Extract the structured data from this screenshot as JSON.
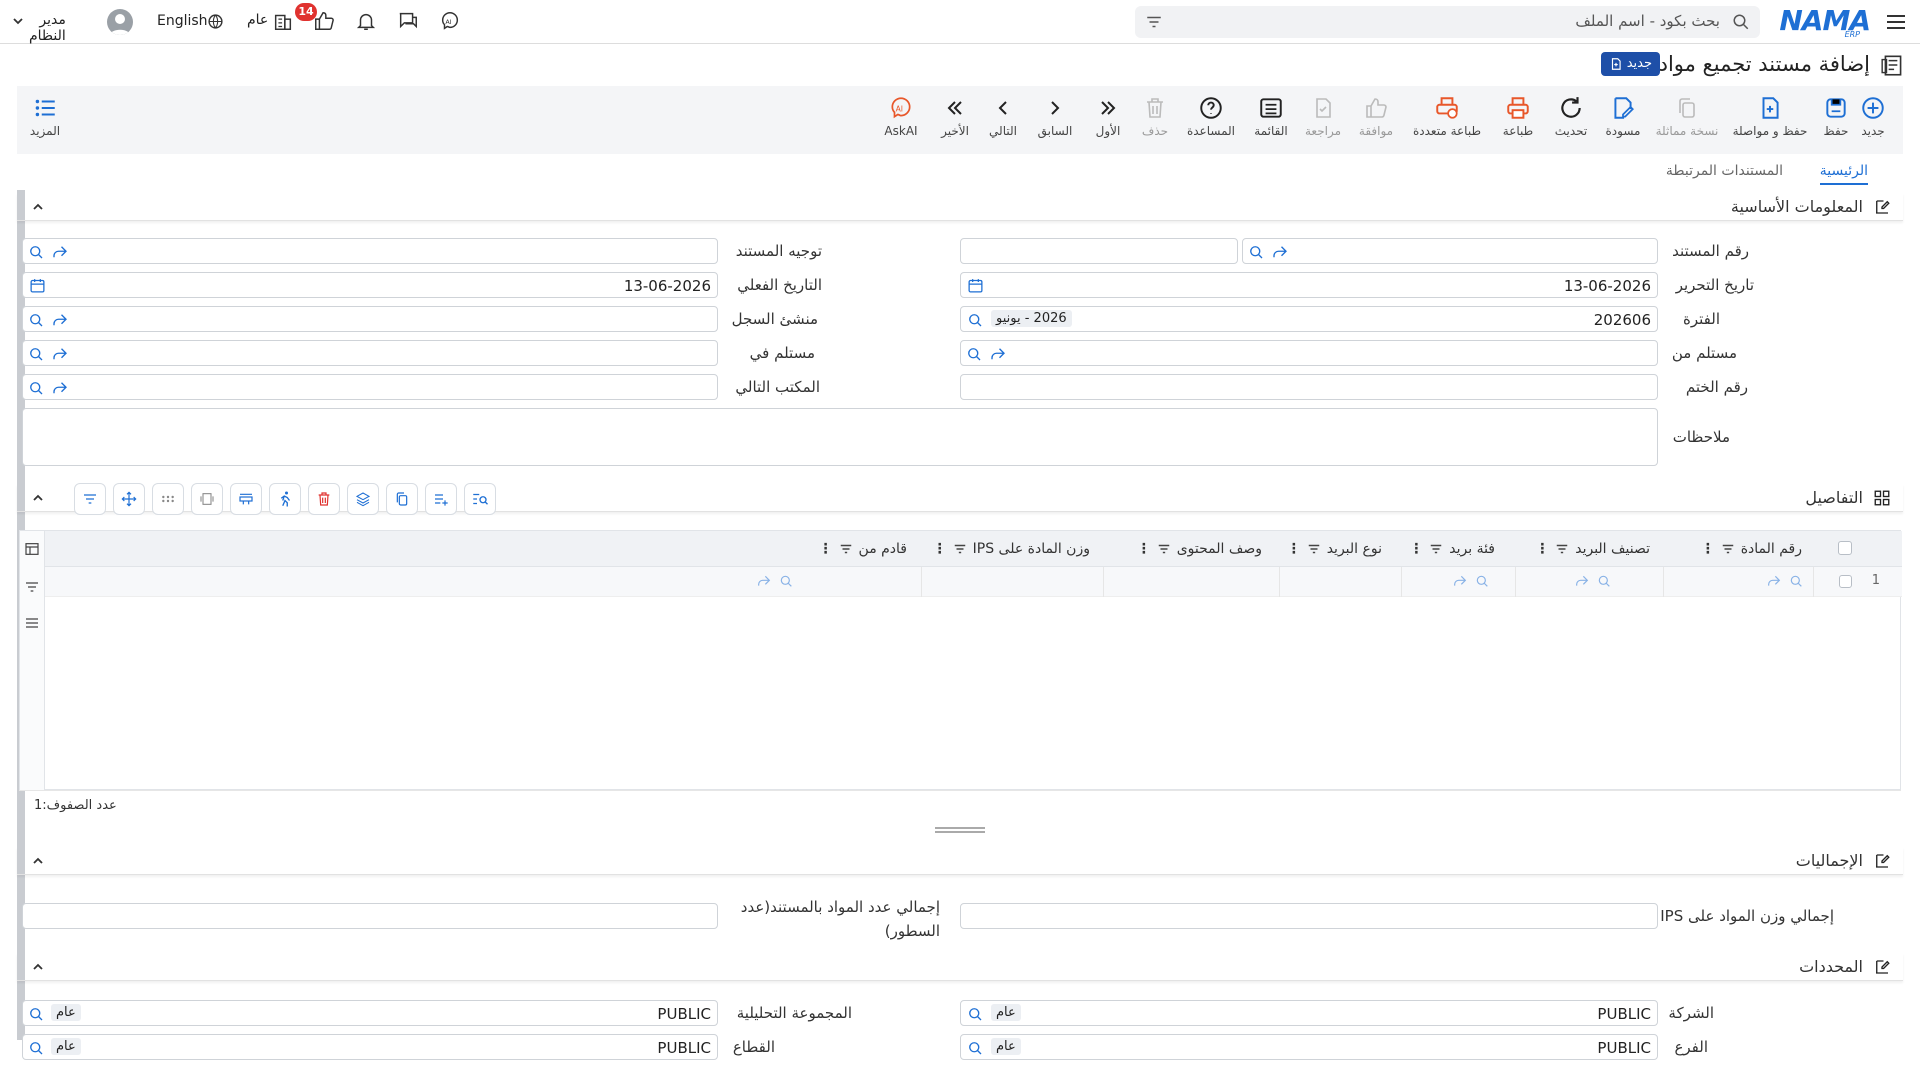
{
  "topbar": {
    "logo": "NAMA",
    "logo_sub": "ERP",
    "search_placeholder": "بحث بكود - اسم الملف",
    "user_name": "مدير النظام",
    "language": "English",
    "general_label": "عام",
    "notif_count": "14"
  },
  "page": {
    "title": "إضافة مستند تجميع مواد",
    "new_badge": "جديد"
  },
  "toolbar": {
    "buttons": [
      {
        "label": "جديد",
        "icon": "plus-circle-icon"
      },
      {
        "label": "حفظ",
        "icon": "save-icon"
      },
      {
        "label": "حفظ و مواصلة",
        "icon": "save-continue-icon"
      },
      {
        "label": "نسخة مماثلة",
        "icon": "copy-icon"
      },
      {
        "label": "مسودة",
        "icon": "draft-icon"
      },
      {
        "label": "تحديث",
        "icon": "refresh-icon"
      },
      {
        "label": "طباعة",
        "icon": "print-icon"
      },
      {
        "label": "طباعة متعددة",
        "icon": "multi-print-icon"
      },
      {
        "label": "موافقة",
        "icon": "approve-icon"
      },
      {
        "label": "مراجعة",
        "icon": "review-icon"
      },
      {
        "label": "القائمة",
        "icon": "list-icon"
      },
      {
        "label": "المساعدة",
        "icon": "help-icon"
      },
      {
        "label": "حذف",
        "icon": "delete-icon"
      },
      {
        "label": "الأول",
        "icon": "first-icon"
      },
      {
        "label": "السابق",
        "icon": "previous-icon"
      },
      {
        "label": "التالي",
        "icon": "next-icon"
      },
      {
        "label": "الأخير",
        "icon": "last-icon"
      },
      {
        "label": "AskAI",
        "icon": "ai-icon"
      }
    ],
    "more_label": "المزيد"
  },
  "tabs": {
    "main": "الرئيسية",
    "related": "المستندات المرتبطة"
  },
  "sections": {
    "basic": "المعلومات الأساسية",
    "details": "التفاصيل",
    "totals": "الإجماليات",
    "dimensions": "المحددات"
  },
  "basic": {
    "doc_number_label": "رقم المستند",
    "doc_direction_label": "توجيه المستند",
    "edit_date_label": "تاريخ التحرير",
    "edit_date_value": "13-06-2026",
    "actual_date_label": "التاريخ الفعلي",
    "actual_date_value": "13-06-2026",
    "period_label": "الفترة",
    "period_value": "202606",
    "period_tag": "2026 - يونيو",
    "record_origin_label": "منشئ السجل",
    "received_from_label": "مستلم من",
    "received_in_label": "مستلم في",
    "stamp_no_label": "رقم الختم",
    "next_office_label": "المكتب التالي",
    "notes_label": "ملاحظات"
  },
  "grid": {
    "columns": [
      "رقم المادة",
      "تصنيف البريد",
      "فئة بريد",
      "نوع البريد",
      "وصف المحتوى",
      "وزن المادة على IPS",
      "قادم من"
    ],
    "rows": [
      {
        "num": "1"
      }
    ],
    "row_count_label": "عدد الصفوف:",
    "row_count": "1"
  },
  "totals": {
    "total_weight_label": "إجمالي وزن المواد على IPS",
    "total_count_label": "إجمالي عدد المواد بالمستند(عدد السطور)"
  },
  "dimensions": {
    "company_label": "الشركة",
    "company_value": "PUBLIC",
    "company_tag": "عام",
    "analytic_label": "المجموعة التحليلية",
    "analytic_value": "PUBLIC",
    "analytic_tag": "عام",
    "branch_label": "الفرع",
    "branch_value": "PUBLIC",
    "branch_tag": "عام",
    "sector_label": "القطاع",
    "sector_value": "PUBLIC",
    "sector_tag": "عام"
  },
  "colors": {
    "primary": "#1e6fd4",
    "print": "#e8572a",
    "badge": "#e0322f",
    "new_badge": "#1e4fa8"
  }
}
